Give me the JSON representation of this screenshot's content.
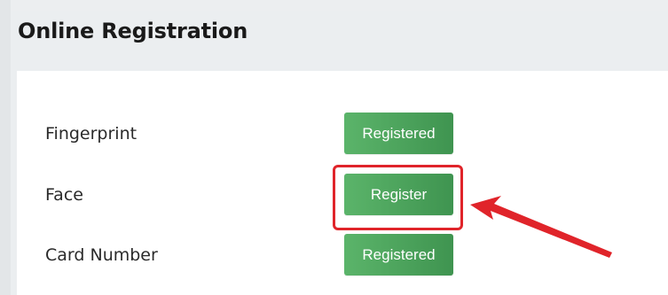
{
  "panel": {
    "title": "Online Registration"
  },
  "rows": [
    {
      "label": "Fingerprint",
      "button_label": "Registered"
    },
    {
      "label": "Face",
      "button_label": "Register"
    },
    {
      "label": "Card Number",
      "button_label": "Registered"
    }
  ],
  "colors": {
    "button_green": "#4aa35b",
    "highlight_red": "#e0242a"
  },
  "icons": {
    "annotation_arrow": "red-arrow-icon"
  }
}
